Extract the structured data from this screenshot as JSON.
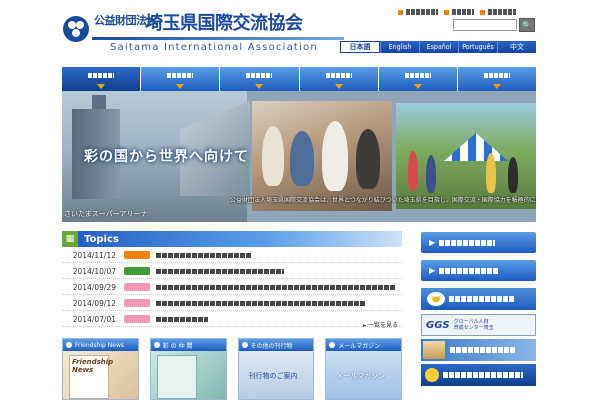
{
  "header": {
    "corp_type": "公益財団法人",
    "org_name": "埼玉県国際交流協会",
    "org_name_en": "Saitama International Association",
    "search": {
      "placeholder": "",
      "button_glyph": "🔍"
    }
  },
  "languages": [
    {
      "label": "日本語",
      "active": true
    },
    {
      "label": "English",
      "active": false
    },
    {
      "label": "Español",
      "active": false
    },
    {
      "label": "Português",
      "active": false
    },
    {
      "label": "中文",
      "active": false
    }
  ],
  "hero": {
    "catchphrase": "彩の国から世界へ向けて",
    "photo_caption": "さいたまスーパーアリーナ",
    "description": "公益財団法人埼玉県国際交流協会は、世界とつながり結びついた埼玉県を目指し、国際交流・国際協力を積極的に進めるとともに、世界を舞台に活躍できるグローバル人材の育成に取り組んでいます。"
  },
  "topics": {
    "title": "Topics",
    "icon_glyph": "▦",
    "more_label": "▸ 一覧を見る",
    "items": [
      {
        "date": "2014/11/12",
        "badge_color": "#f08300"
      },
      {
        "date": "2014/10/07",
        "badge_color": "#3f9a3a"
      },
      {
        "date": "2014/09/29",
        "badge_color": "#f29ab5"
      },
      {
        "date": "2014/09/12",
        "badge_color": "#f29ab5"
      },
      {
        "date": "2014/07/01",
        "badge_color": "#f29ab5"
      }
    ]
  },
  "sidebar": {
    "supporter_icon": "🤝",
    "ggs_logo": "GGS",
    "ggs_sub1": "グローバル人材",
    "ggs_sub2": "育成センター埼玉"
  },
  "boxes": [
    {
      "title": "Friendship News",
      "cover": "Friendship News"
    },
    {
      "title": "彩 の 仲 間",
      "cover": ""
    },
    {
      "title": "その他の刊行物",
      "label": "刊行物のご案内"
    },
    {
      "title": "メールマガジン",
      "label": "メールマガジン"
    }
  ]
}
